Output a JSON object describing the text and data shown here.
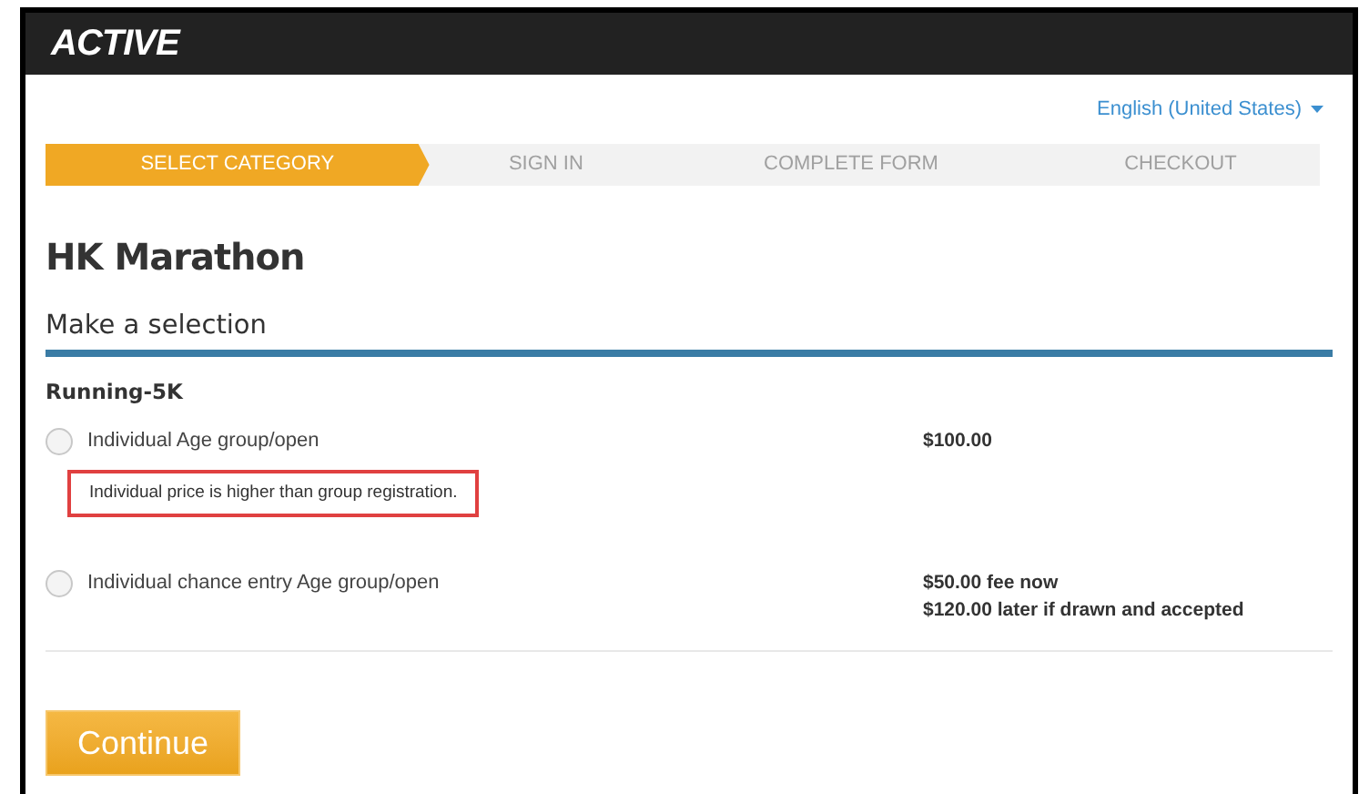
{
  "header": {
    "logo": "ACTIVE"
  },
  "language": {
    "label": "English (United States)"
  },
  "steps": [
    {
      "label": "SELECT CATEGORY",
      "selected": true
    },
    {
      "label": "SIGN IN",
      "selected": false
    },
    {
      "label": "COMPLETE FORM",
      "selected": false
    },
    {
      "label": "CHECKOUT",
      "selected": false
    }
  ],
  "title": "HK Marathon",
  "section_title": "Make a selection",
  "category": "Running-5K",
  "options": [
    {
      "label": "Individual Age group/open",
      "selected": false,
      "prices": [
        "$100.00"
      ],
      "note": "Individual price is higher than group registration."
    },
    {
      "label": "Individual chance entry Age group/open",
      "selected": false,
      "prices": [
        "$50.00 fee now",
        "$120.00 later if drawn and accepted"
      ]
    }
  ],
  "continue_button": "Continue"
}
